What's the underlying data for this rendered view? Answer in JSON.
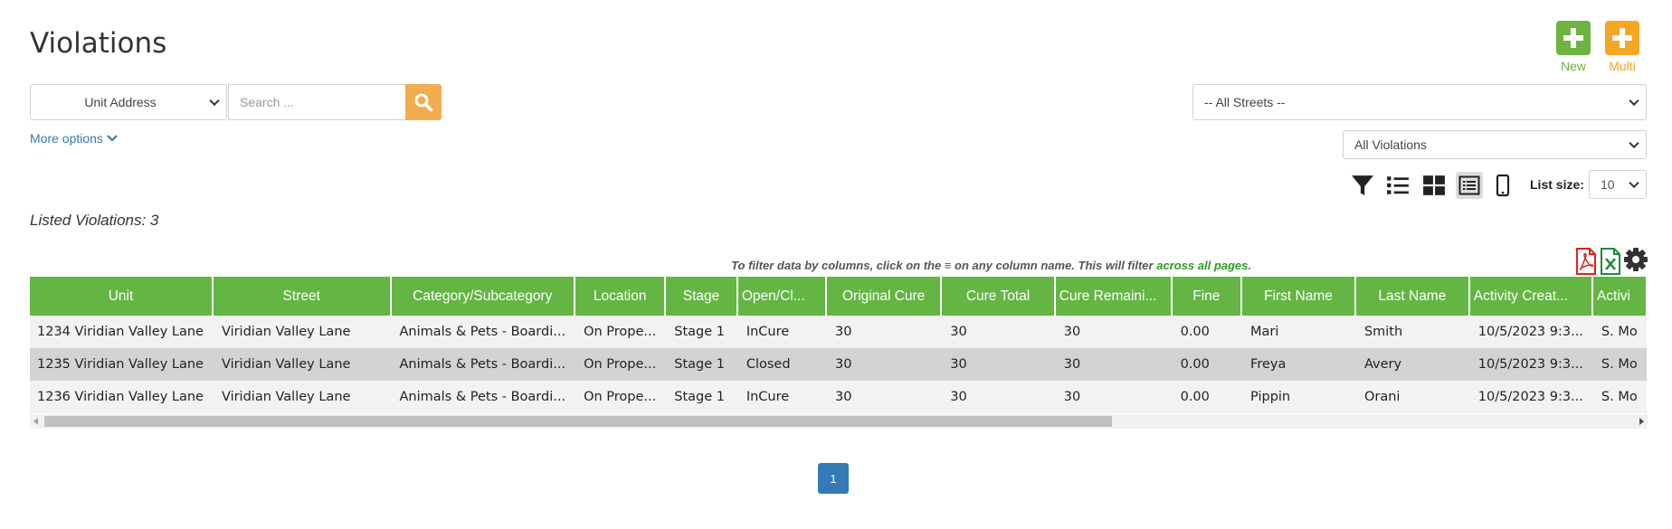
{
  "header": {
    "title": "Violations"
  },
  "actions": {
    "new_label": "New",
    "multi_label": "Multi",
    "new_color": "#6cb33f",
    "multi_color": "#f5a623"
  },
  "search": {
    "field_selected": "Unit Address",
    "placeholder": "Search ..."
  },
  "filters": {
    "street_selected": "-- All Streets --",
    "violation_selected": "All Violations",
    "more_options_label": "More options"
  },
  "view": {
    "icons": [
      "filter-icon",
      "list-icon",
      "grid-icon",
      "detail-list-icon",
      "mobile-icon"
    ],
    "active": "detail-list-icon",
    "list_size_label": "List size:",
    "list_size_value": "10"
  },
  "listing": {
    "count_text": "Listed Violations: 3"
  },
  "hint": {
    "prefix": "To filter data by columns, click on the ≡ on any column name. This will filter ",
    "highlight": "across all pages."
  },
  "table": {
    "headers": [
      "Unit",
      "Street",
      "Category/Subcategory",
      "Location",
      "Stage",
      "Open/Cl...",
      "Original Cure",
      "Cure Total",
      "Cure Remaini...",
      "Fine",
      "First Name",
      "Last Name",
      "Activity Creat...",
      "Activi"
    ],
    "rows": [
      [
        "1234 Viridian Valley Lane",
        "Viridian Valley Lane",
        "Animals & Pets - Boardi...",
        "On Prope...",
        "Stage 1",
        "InCure",
        "30",
        "30",
        "30",
        "0.00",
        "Mari",
        "Smith",
        "10/5/2023 9:3...",
        "S. Mo"
      ],
      [
        "1235 Viridian Valley Lane",
        "Viridian Valley Lane",
        "Animals & Pets - Boardi...",
        "On Prope...",
        "Stage 1",
        "Closed",
        "30",
        "30",
        "30",
        "0.00",
        "Freya",
        "Avery",
        "10/5/2023 9:3...",
        "S. Mo"
      ],
      [
        "1236 Viridian Valley Lane",
        "Viridian Valley Lane",
        "Animals & Pets - Boardi...",
        "On Prope...",
        "Stage 1",
        "InCure",
        "30",
        "30",
        "30",
        "0.00",
        "Pippin",
        "Orani",
        "10/5/2023 9:3...",
        "S. Mo"
      ]
    ]
  },
  "pagination": {
    "current": "1"
  },
  "colors": {
    "accent_green": "#64b543",
    "search_orange": "#f0ad4e",
    "link_blue": "#337ab7"
  }
}
